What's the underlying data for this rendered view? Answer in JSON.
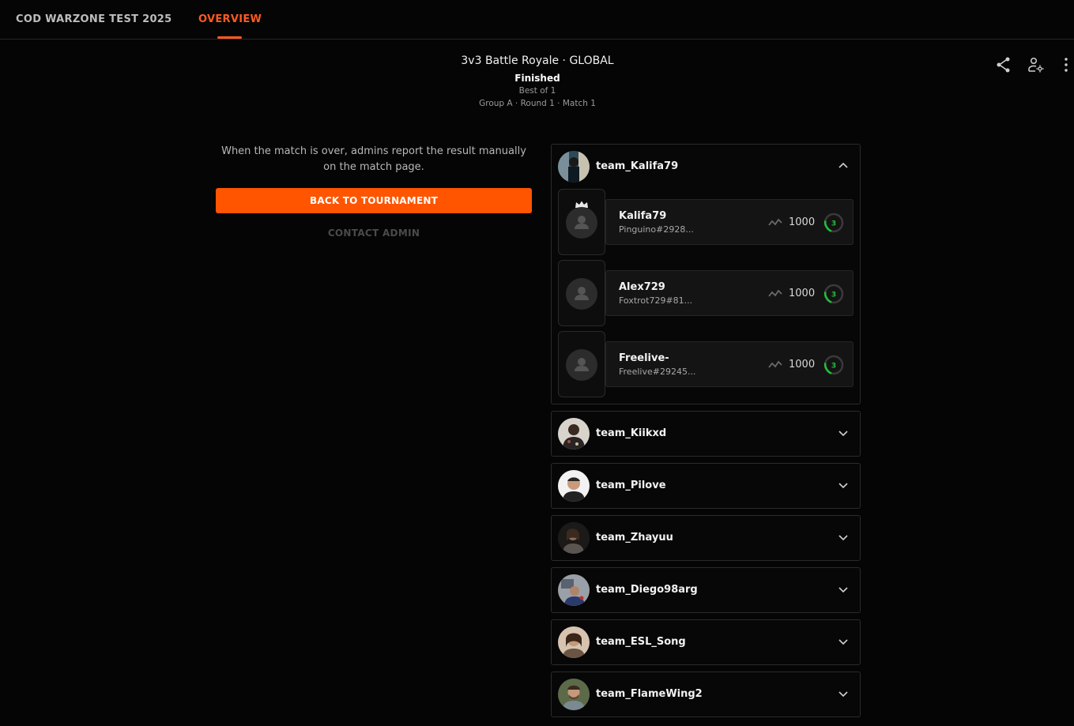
{
  "nav": {
    "title": "COD WARZONE TEST 2025",
    "tab": "OVERVIEW"
  },
  "header": {
    "title": "3v3 Battle Royale · GLOBAL",
    "status": "Finished",
    "best_of": "Best of 1",
    "location": "Group A · Round 1 · Match 1"
  },
  "left": {
    "info": "When the match is over, admins report the result manually on the match page.",
    "back_button": "BACK TO TOURNAMENT",
    "contact_button": "CONTACT ADMIN"
  },
  "accent_color": "#ff5500",
  "teams": [
    {
      "name": "team_Kalifa79",
      "expanded": true,
      "players": [
        {
          "name": "Kalifa79",
          "tag": "Pinguino#2928...",
          "elo": "1000",
          "level": "3",
          "captain": true
        },
        {
          "name": "Alex729",
          "tag": "Foxtrot729#81...",
          "elo": "1000",
          "level": "3",
          "captain": false
        },
        {
          "name": "Freelive-",
          "tag": "Freelive#29245...",
          "elo": "1000",
          "level": "3",
          "captain": false
        }
      ]
    },
    {
      "name": "team_Kiikxd",
      "expanded": false
    },
    {
      "name": "team_Pilove",
      "expanded": false
    },
    {
      "name": "team_Zhayuu",
      "expanded": false
    },
    {
      "name": "team_Diego98arg",
      "expanded": false
    },
    {
      "name": "team_ESL_Song",
      "expanded": false
    },
    {
      "name": "team_FlameWing2",
      "expanded": false
    }
  ]
}
